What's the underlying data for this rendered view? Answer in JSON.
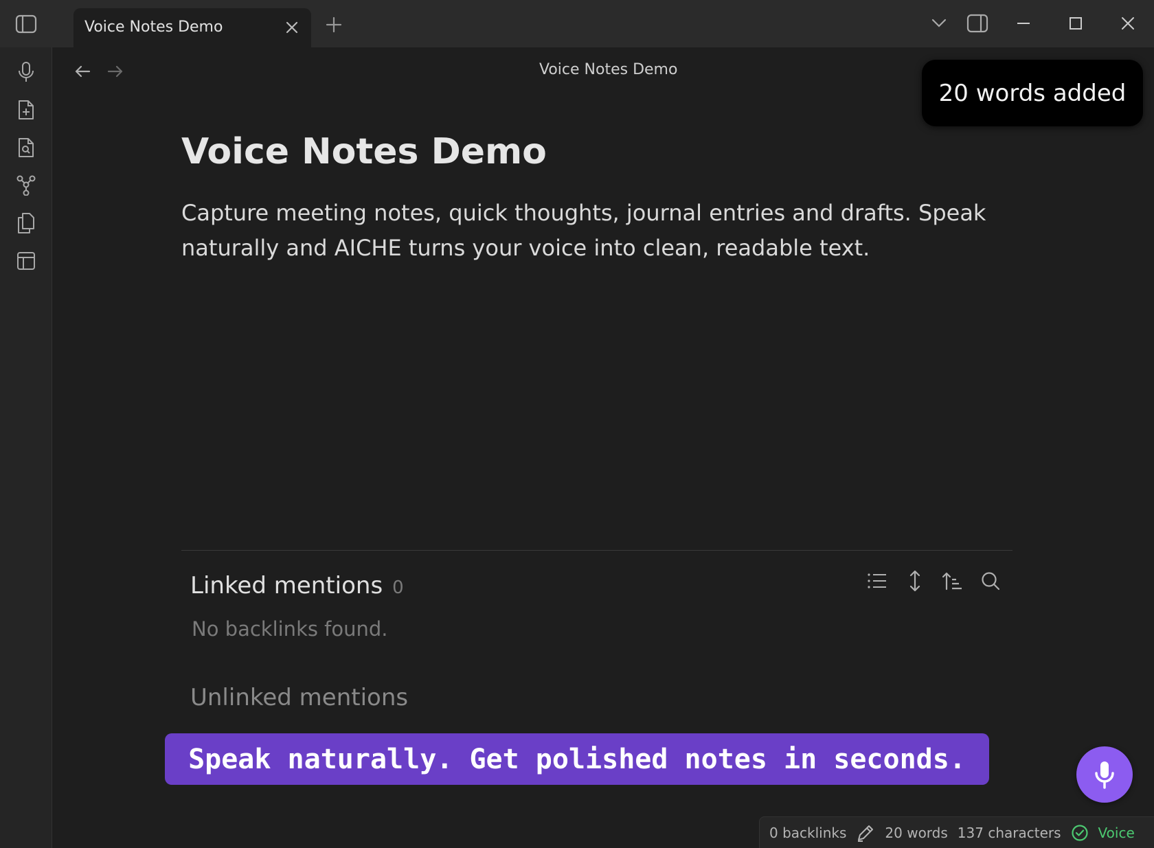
{
  "tab": {
    "title": "Voice Notes Demo"
  },
  "view": {
    "title": "Voice Notes Demo"
  },
  "toast": {
    "text": "20 words added"
  },
  "note": {
    "title": "Voice Notes Demo",
    "body": "Capture meeting notes, quick thoughts, journal entries and drafts. Speak naturally and AICHE turns your voice into clean, readable text."
  },
  "linked_mentions": {
    "label": "Linked mentions",
    "count": "0",
    "empty_text": "No backlinks found."
  },
  "unlinked_mentions": {
    "label": "Unlinked mentions"
  },
  "banner": {
    "text": "Speak naturally. Get polished notes in seconds."
  },
  "statusbar": {
    "backlinks": "0 backlinks",
    "words": "20 words",
    "characters": "137 characters",
    "voice": "Voice"
  },
  "colors": {
    "accent": "#6a3fc7",
    "mic_button": "#8c5cf0",
    "voice_status": "#4cc971"
  },
  "icons": {
    "ribbon": [
      "microphone-icon",
      "new-note-icon",
      "search-note-icon",
      "graph-icon",
      "copy-icon",
      "layout-icon"
    ],
    "linked_tools": [
      "list-icon",
      "expand-icon",
      "sort-icon",
      "search-icon"
    ]
  }
}
